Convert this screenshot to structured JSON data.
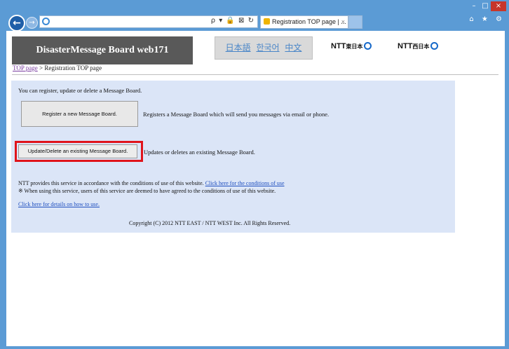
{
  "browser": {
    "back_glyph": "←",
    "forward_glyph": "→",
    "address_tools": "ρ ▾ 🔒 ⊠ ↻",
    "tab_title": "Registration TOP page | ...",
    "tab_close": "×",
    "window_controls": [
      "–",
      "□",
      "×"
    ],
    "command_icons": "⌂ ★ ⚙"
  },
  "header": {
    "site_title": "DisasterMessage Board web171",
    "languages": [
      "日本語",
      "한국어",
      "中文"
    ],
    "logo_east": {
      "main": "NTT",
      "sub": "東日本"
    },
    "logo_west": {
      "main": "NTT",
      "sub": "西日本"
    }
  },
  "breadcrumb": {
    "top_link": "TOP page",
    "separator": ">",
    "current": "Registration TOP page"
  },
  "main": {
    "intro": "You can register, update or delete a Message Board.",
    "register_button": "Register a new Message Board.",
    "register_desc": "Registers a Message Board which will send you messages via email or phone.",
    "update_button": "Update/Delete an existing Message Board.",
    "update_desc": "Updates or deletes an existing Message Board.",
    "terms_text": "NTT provides this service in accordance with the conditions of use of this website.",
    "terms_link": "Click here for the conditions of use",
    "terms_note": "※ When using this service, users of this service are deemed to have agreed to the conditions of use of this website.",
    "howto_link": "Click here for details on how to use.",
    "copyright": "Copyright (C) 2012 NTT EAST / NTT WEST Inc. All Rights Reserved."
  },
  "colors": {
    "window_frame": "#5b9bd5",
    "title_bg": "#595959",
    "panel_bg": "#dbe5f7",
    "highlight": "#e0141b",
    "link": "#1f4fbf"
  }
}
